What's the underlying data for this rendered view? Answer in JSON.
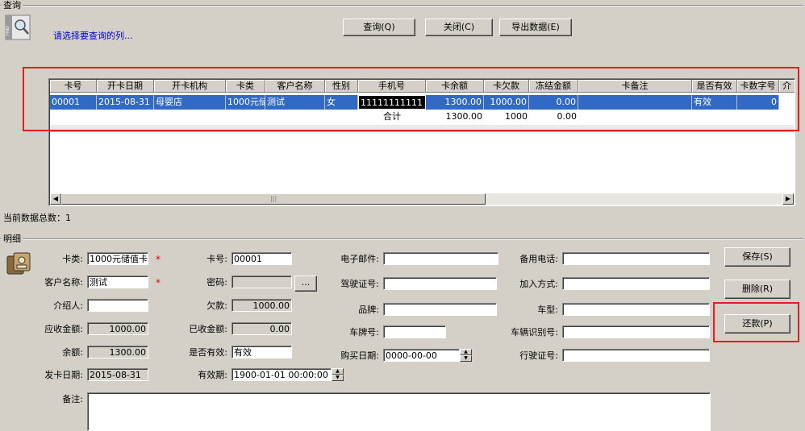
{
  "query_group": {
    "title": "查询",
    "prompt": "请选择要查询的列..."
  },
  "buttons": {
    "query": "查询(Q)",
    "close": "关闭(C)",
    "export": "导出数据(E)",
    "save": "保存(S)",
    "delete": "删除(R)",
    "repay": "还款(P)",
    "browse": "..."
  },
  "grid": {
    "columns": [
      "卡号",
      "开卡日期",
      "开卡机构",
      "卡类",
      "客户名称",
      "性别",
      "手机号",
      "卡余额",
      "卡欠款",
      "冻结金额",
      "卡备注",
      "是否有效",
      "卡数字号",
      "介"
    ],
    "row": [
      "00001",
      "2015-08-31",
      "母婴店",
      "1000元储",
      "测试",
      "女",
      "11111111111",
      "1300.00",
      "1000.00",
      "0.00",
      "",
      "有效",
      "0",
      ""
    ],
    "total": {
      "label": "合计",
      "balance": "1300.00",
      "debt": "1000",
      "frozen": "0.00"
    }
  },
  "status": {
    "count_label": "当前数据总数：1"
  },
  "detail_group": {
    "title": "明细"
  },
  "detail": {
    "card_type_label": "卡类:",
    "card_type": "1000元储值卡",
    "customer_label": "客户名称:",
    "customer": "测试",
    "referrer_label": "介绍人:",
    "referrer": "",
    "receivable_label": "应收金额:",
    "receivable": "1000.00",
    "balance_label": "余额:",
    "balance": "1300.00",
    "issue_date_label": "发卡日期:",
    "issue_date": "2015-08-31",
    "remark_label": "备注:",
    "remark": "",
    "card_no_label": "卡号:",
    "card_no": "00001",
    "password_label": "密码:",
    "password": "",
    "debt_label": "欠款:",
    "debt": "1000.00",
    "received_label": "已收金额:",
    "received": "0.00",
    "valid_label": "是否有效:",
    "valid": "有效",
    "expiry_label": "有效期:",
    "expiry": "1900-01-01 00:00:00",
    "email_label": "电子邮件:",
    "email": "",
    "license_label": "驾驶证号:",
    "license": "",
    "brand_label": "品牌:",
    "brand": "",
    "plate_label": "车牌号:",
    "plate": "",
    "purchase_label": "购买日期:",
    "purchase": "0000-00-00",
    "alt_phone_label": "备用电话:",
    "alt_phone": "",
    "join_label": "加入方式:",
    "join": "",
    "model_label": "车型:",
    "model": "",
    "vin_label": "车辆识别号:",
    "vin": "",
    "reg_label": "行驶证号:",
    "reg": ""
  },
  "colors": {
    "selection": "#316ac5",
    "highlight_box": "#e02020",
    "required": "#e00000",
    "prompt_text": "#0000cc"
  }
}
